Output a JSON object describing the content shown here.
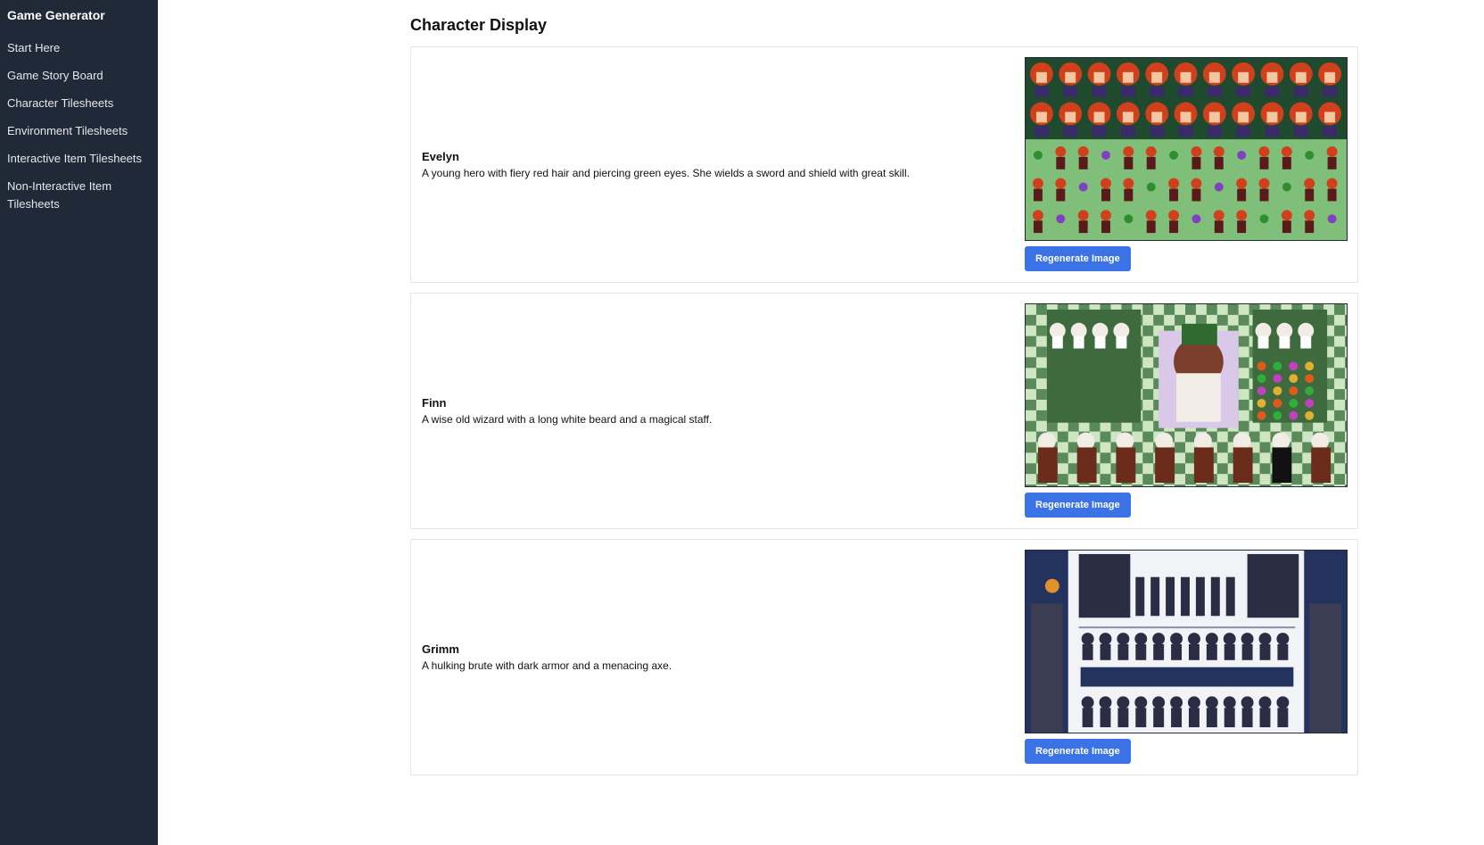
{
  "sidebar": {
    "brand": "Game Generator",
    "items": [
      {
        "label": "Start Here"
      },
      {
        "label": "Game Story Board"
      },
      {
        "label": "Character Tilesheets"
      },
      {
        "label": "Environment Tilesheets"
      },
      {
        "label": "Interactive Item Tilesheets"
      },
      {
        "label": "Non-Interactive Item Tilesheets"
      }
    ]
  },
  "main": {
    "title": "Character Display",
    "characters": [
      {
        "name": "Evelyn",
        "description": "A young hero with fiery red hair and piercing green eyes. She wields a sword and shield with great skill.",
        "button_label": "Regenerate Image",
        "palette": {
          "bg": "#7fbf7a",
          "band": "#1f4a2e",
          "hair": "#d1401c",
          "cloak": "#3a2a6a"
        }
      },
      {
        "name": "Finn",
        "description": "A wise old wizard with a long white beard and a magical staff.",
        "button_label": "Regenerate Image",
        "palette": {
          "bg": "#5b8a5a",
          "check": "#cfe6c4",
          "beard": "#f1ece6",
          "robe": "#6b2c1c"
        }
      },
      {
        "name": "Grimm",
        "description": "A hulking brute with dark armor and a menacing axe.",
        "button_label": "Regenerate Image",
        "palette": {
          "bg": "#f2f3f6",
          "armor": "#2b2d44",
          "night": "#23335e",
          "flame": "#e0912a"
        }
      }
    ]
  }
}
